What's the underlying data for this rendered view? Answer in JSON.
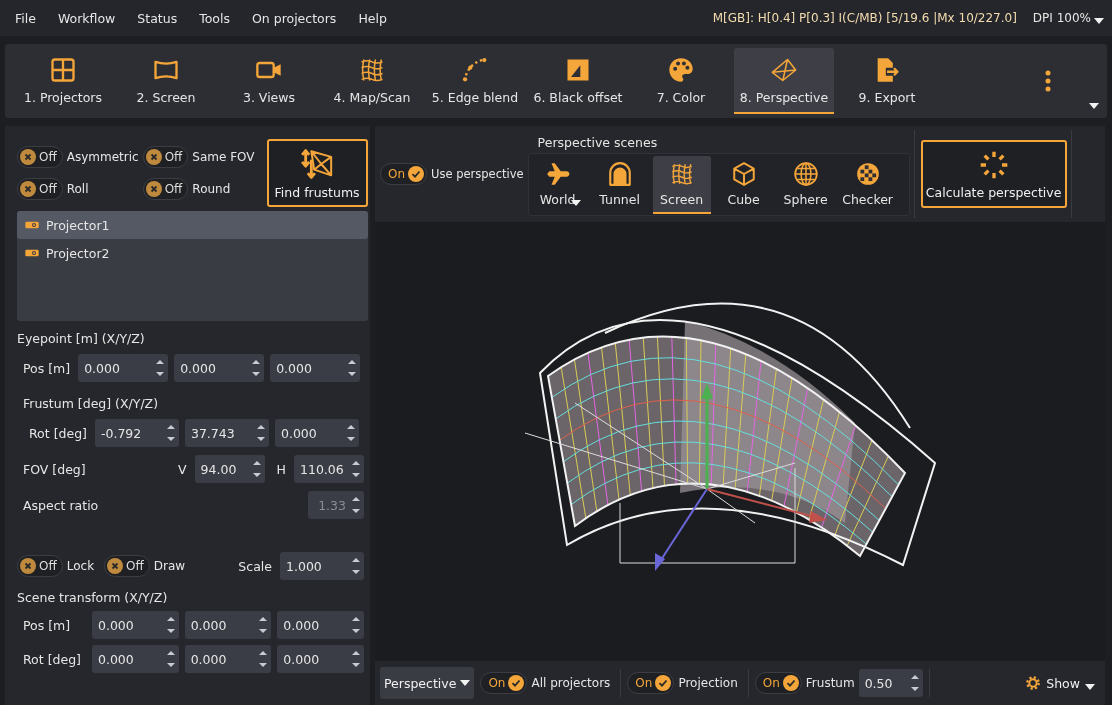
{
  "menu": [
    "File",
    "Workflow",
    "Status",
    "Tools",
    "On projectors",
    "Help"
  ],
  "status_text": "M[GB]: H[0.4] P[0.3] I(C/MB) [5/19.6 |Mx 10/227.0]",
  "dpi": "DPI 100%",
  "toolbar": [
    {
      "label": "1. Projectors",
      "kind": "grid",
      "selected": false
    },
    {
      "label": "2. Screen",
      "kind": "screen",
      "selected": false
    },
    {
      "label": "3. Views",
      "kind": "camera",
      "selected": false
    },
    {
      "label": "4. Map/Scan",
      "kind": "mesh",
      "selected": false
    },
    {
      "label": "5. Edge blend",
      "kind": "curve",
      "selected": false
    },
    {
      "label": "6. Black offset",
      "kind": "blackoffset",
      "selected": false
    },
    {
      "label": "7. Color",
      "kind": "palette",
      "selected": false
    },
    {
      "label": "8. Perspective",
      "kind": "pyramid",
      "selected": true
    },
    {
      "label": "9. Export",
      "kind": "export",
      "selected": false
    }
  ],
  "left": {
    "options": [
      {
        "state": "Off",
        "on": false,
        "label": "Asymmetric"
      },
      {
        "state": "Off",
        "on": false,
        "label": "Same FOV"
      },
      {
        "state": "Off",
        "on": false,
        "label": "Roll"
      },
      {
        "state": "Off",
        "on": false,
        "label": "Round"
      }
    ],
    "find_button": "Find frustums",
    "projectors": [
      {
        "name": "Projector1",
        "selected": true
      },
      {
        "name": "Projector2",
        "selected": false
      }
    ],
    "eyepoint": {
      "title": "Eyepoint [m] (X/Y/Z)",
      "label": "Pos [m]",
      "values": [
        "0.000",
        "0.000",
        "0.000"
      ]
    },
    "frustum": {
      "title": "Frustum [deg] (X/Y/Z)",
      "label": "Rot [deg]",
      "values": [
        "-0.792",
        "37.743",
        "0.000"
      ]
    },
    "fov": {
      "label": "FOV [deg]",
      "v_label": "V",
      "v": "94.00",
      "h_label": "H",
      "h": "110.06"
    },
    "aspect": {
      "label": "Aspect ratio",
      "value": "1.33",
      "disabled": true
    },
    "lock_draw": [
      {
        "state": "Off",
        "on": false,
        "label": "Lock"
      },
      {
        "state": "Off",
        "on": false,
        "label": "Draw"
      }
    ],
    "scale": {
      "label": "Scale",
      "value": "1.000"
    },
    "scene_transform": {
      "title": "Scene transform (X/Y/Z)",
      "rows": [
        {
          "label": "Pos [m]",
          "values": [
            "0.000",
            "0.000",
            "0.000"
          ]
        },
        {
          "label": "Rot [deg]",
          "values": [
            "0.000",
            "0.000",
            "0.000"
          ]
        }
      ]
    }
  },
  "top": {
    "use_perspective": {
      "state": "On",
      "on": true,
      "label": "Use perspective"
    },
    "scenes_title": "Perspective scenes",
    "scenes": [
      {
        "label": "World",
        "kind": "plane",
        "dropdown": true,
        "selected": false
      },
      {
        "label": "Tunnel",
        "kind": "tunnel",
        "dropdown": false,
        "selected": false
      },
      {
        "label": "Screen",
        "kind": "mesh",
        "dropdown": false,
        "selected": true
      },
      {
        "label": "Cube",
        "kind": "cube",
        "dropdown": false,
        "selected": false
      },
      {
        "label": "Sphere",
        "kind": "globe",
        "dropdown": false,
        "selected": false
      },
      {
        "label": "Checker",
        "kind": "checker",
        "dropdown": false,
        "selected": false
      }
    ],
    "calculate_button": "Calculate perspective"
  },
  "bottom": {
    "view_mode": "Perspective",
    "toggles": [
      {
        "state": "On",
        "on": true,
        "label": "All projectors"
      },
      {
        "state": "On",
        "on": true,
        "label": "Projection"
      },
      {
        "state": "On",
        "on": true,
        "label": "Frustum"
      }
    ],
    "frustum_size": "0.50",
    "show": "Show"
  }
}
